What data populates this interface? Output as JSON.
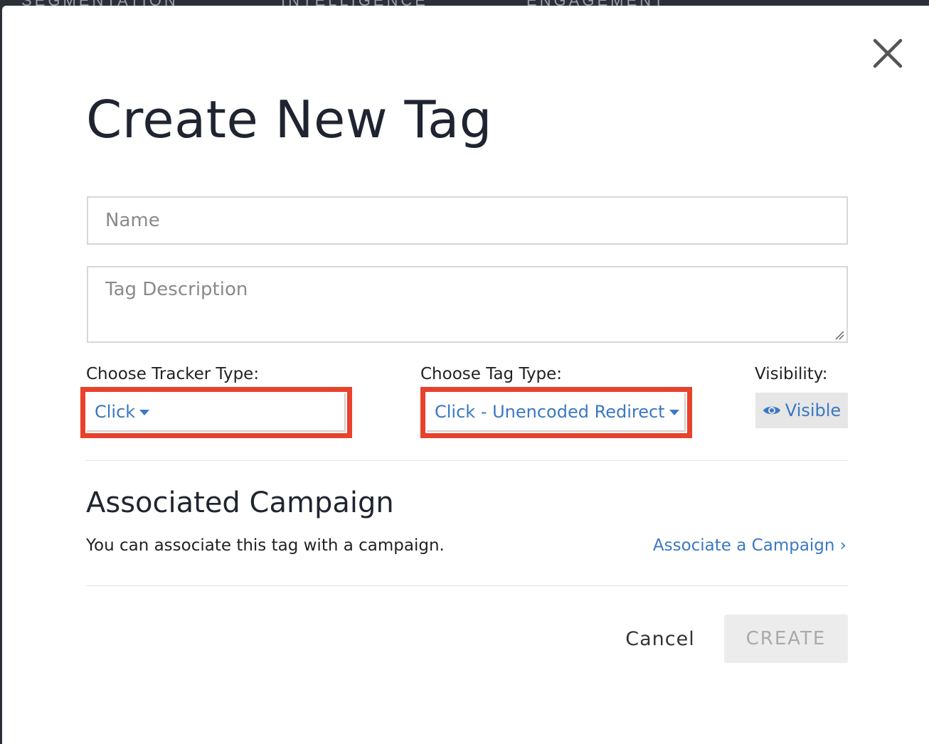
{
  "background_nav": {
    "items": [
      "SEGMENTATION",
      "INTELLIGENCE",
      "ENGAGEMENT"
    ]
  },
  "modal": {
    "title": "Create New Tag",
    "close_icon": "close-icon",
    "name_field": {
      "placeholder": "Name",
      "value": ""
    },
    "description_field": {
      "placeholder": "Tag Description",
      "value": ""
    },
    "tracker_type": {
      "label": "Choose Tracker Type:",
      "selected": "Click",
      "highlighted": true
    },
    "tag_type": {
      "label": "Choose Tag Type:",
      "selected": "Click - Unencoded Redirect",
      "highlighted": true
    },
    "visibility": {
      "label": "Visibility:",
      "value": "Visible",
      "icon": "eye-icon"
    },
    "associated_campaign": {
      "title": "Associated Campaign",
      "description": "You can associate this tag with a campaign.",
      "link_label": "Associate a Campaign ›"
    },
    "actions": {
      "cancel_label": "Cancel",
      "create_label": "CREATE",
      "create_enabled": false
    }
  },
  "colors": {
    "accent": "#3b78c3",
    "highlight_border": "#e8412c",
    "title_text": "#1f2430",
    "disabled_button_bg": "#ececec"
  }
}
